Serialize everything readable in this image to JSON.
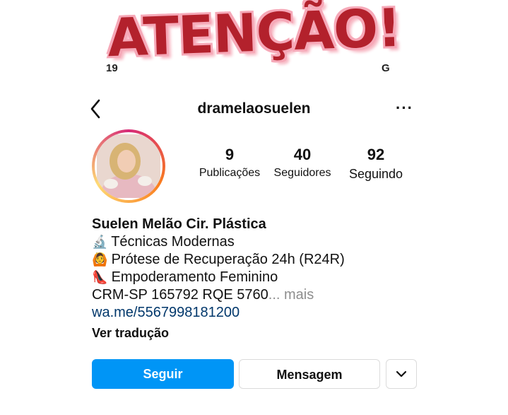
{
  "banner": {
    "text": "ATENÇÃO!"
  },
  "status": {
    "time": "19",
    "right": "G"
  },
  "header": {
    "username": "dramelaosuelen",
    "more": "···"
  },
  "stats": [
    {
      "value": "9",
      "label": "Publicações"
    },
    {
      "value": "40",
      "label": "Seguidores"
    },
    {
      "value": "92",
      "label": "Seguindo"
    }
  ],
  "bio": {
    "name": "Suelen Melão Cir. Plástica",
    "lines": [
      {
        "icon": "microscope-icon",
        "emoji": "🔬",
        "text": "Técnicas Modernas"
      },
      {
        "icon": "woman-icon",
        "emoji": "🙆",
        "text": "Prótese de Recuperação 24h (R24R)"
      },
      {
        "icon": "high-heel-icon",
        "emoji": "👠",
        "text": "Empoderamento Feminino"
      }
    ],
    "crm": "CRM-SP 165792 RQE 5760",
    "ellipsis": "...",
    "more": " mais",
    "link": "wa.me/5567998181200",
    "translate": "Ver tradução"
  },
  "actions": {
    "follow": "Seguir",
    "message": "Mensagem",
    "dropdown": "⌄"
  },
  "colors": {
    "follow_button": "#0095f6",
    "banner_text": "#b3212c",
    "banner_glow": "#f6a9b8",
    "link": "#00376b"
  }
}
